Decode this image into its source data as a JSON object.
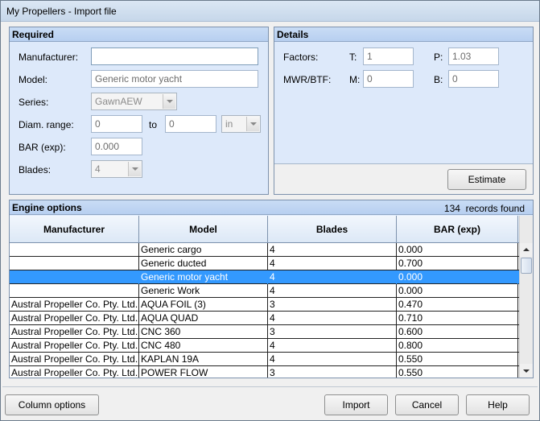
{
  "window": {
    "title": "My Propellers - Import file"
  },
  "required": {
    "header": "Required",
    "manufacturer_label": "Manufacturer:",
    "manufacturer_value": "",
    "model_label": "Model:",
    "model_value": "Generic motor yacht",
    "series_label": "Series:",
    "series_value": "GawnAEW",
    "diam_label": "Diam. range:",
    "diam_from": "0",
    "diam_to_label": "to",
    "diam_to": "0",
    "diam_unit": "in",
    "bar_label": "BAR (exp):",
    "bar_value": "0.000",
    "blades_label": "Blades:",
    "blades_value": "4"
  },
  "details": {
    "header": "Details",
    "factors_label": "Factors:",
    "t_label": "T:",
    "t_value": "1",
    "p_label": "P:",
    "p_value": "1.03",
    "mwr_label": "MWR/BTF:",
    "m_label": "M:",
    "m_value": "0",
    "b_label": "B:",
    "b_value": "0",
    "estimate_label": "Estimate"
  },
  "engine": {
    "header": "Engine options",
    "records_count": "134",
    "records_suffix": "records found",
    "columns": [
      "Manufacturer",
      "Model",
      "Blades",
      "BAR (exp)"
    ],
    "rows": [
      {
        "manufacturer": "",
        "model": "Generic cargo",
        "blades": "4",
        "bar": "0.000",
        "selected": false
      },
      {
        "manufacturer": "",
        "model": "Generic ducted",
        "blades": "4",
        "bar": "0.700",
        "selected": false
      },
      {
        "manufacturer": "",
        "model": "Generic motor yacht",
        "blades": "4",
        "bar": "0.000",
        "selected": true
      },
      {
        "manufacturer": "",
        "model": "Generic Work",
        "blades": "4",
        "bar": "0.000",
        "selected": false
      },
      {
        "manufacturer": "Austral Propeller Co. Pty. Ltd.",
        "model": "AQUA FOIL (3)",
        "blades": "3",
        "bar": "0.470",
        "selected": false
      },
      {
        "manufacturer": "Austral Propeller Co. Pty. Ltd.",
        "model": "AQUA QUAD",
        "blades": "4",
        "bar": "0.710",
        "selected": false
      },
      {
        "manufacturer": "Austral Propeller Co. Pty. Ltd.",
        "model": "CNC 360",
        "blades": "3",
        "bar": "0.600",
        "selected": false
      },
      {
        "manufacturer": "Austral Propeller Co. Pty. Ltd.",
        "model": "CNC 480",
        "blades": "4",
        "bar": "0.800",
        "selected": false
      },
      {
        "manufacturer": "Austral Propeller Co. Pty. Ltd.",
        "model": "KAPLAN 19A",
        "blades": "4",
        "bar": "0.550",
        "selected": false
      },
      {
        "manufacturer": "Austral Propeller Co. Pty. Ltd.",
        "model": "POWER FLOW",
        "blades": "3",
        "bar": "0.550",
        "selected": false
      }
    ]
  },
  "buttons": {
    "column_options": "Column options",
    "import": "Import",
    "cancel": "Cancel",
    "help": "Help"
  },
  "colors": {
    "selection": "#3399ff",
    "panel": "#dde9fa",
    "header": "#b7cff0"
  }
}
